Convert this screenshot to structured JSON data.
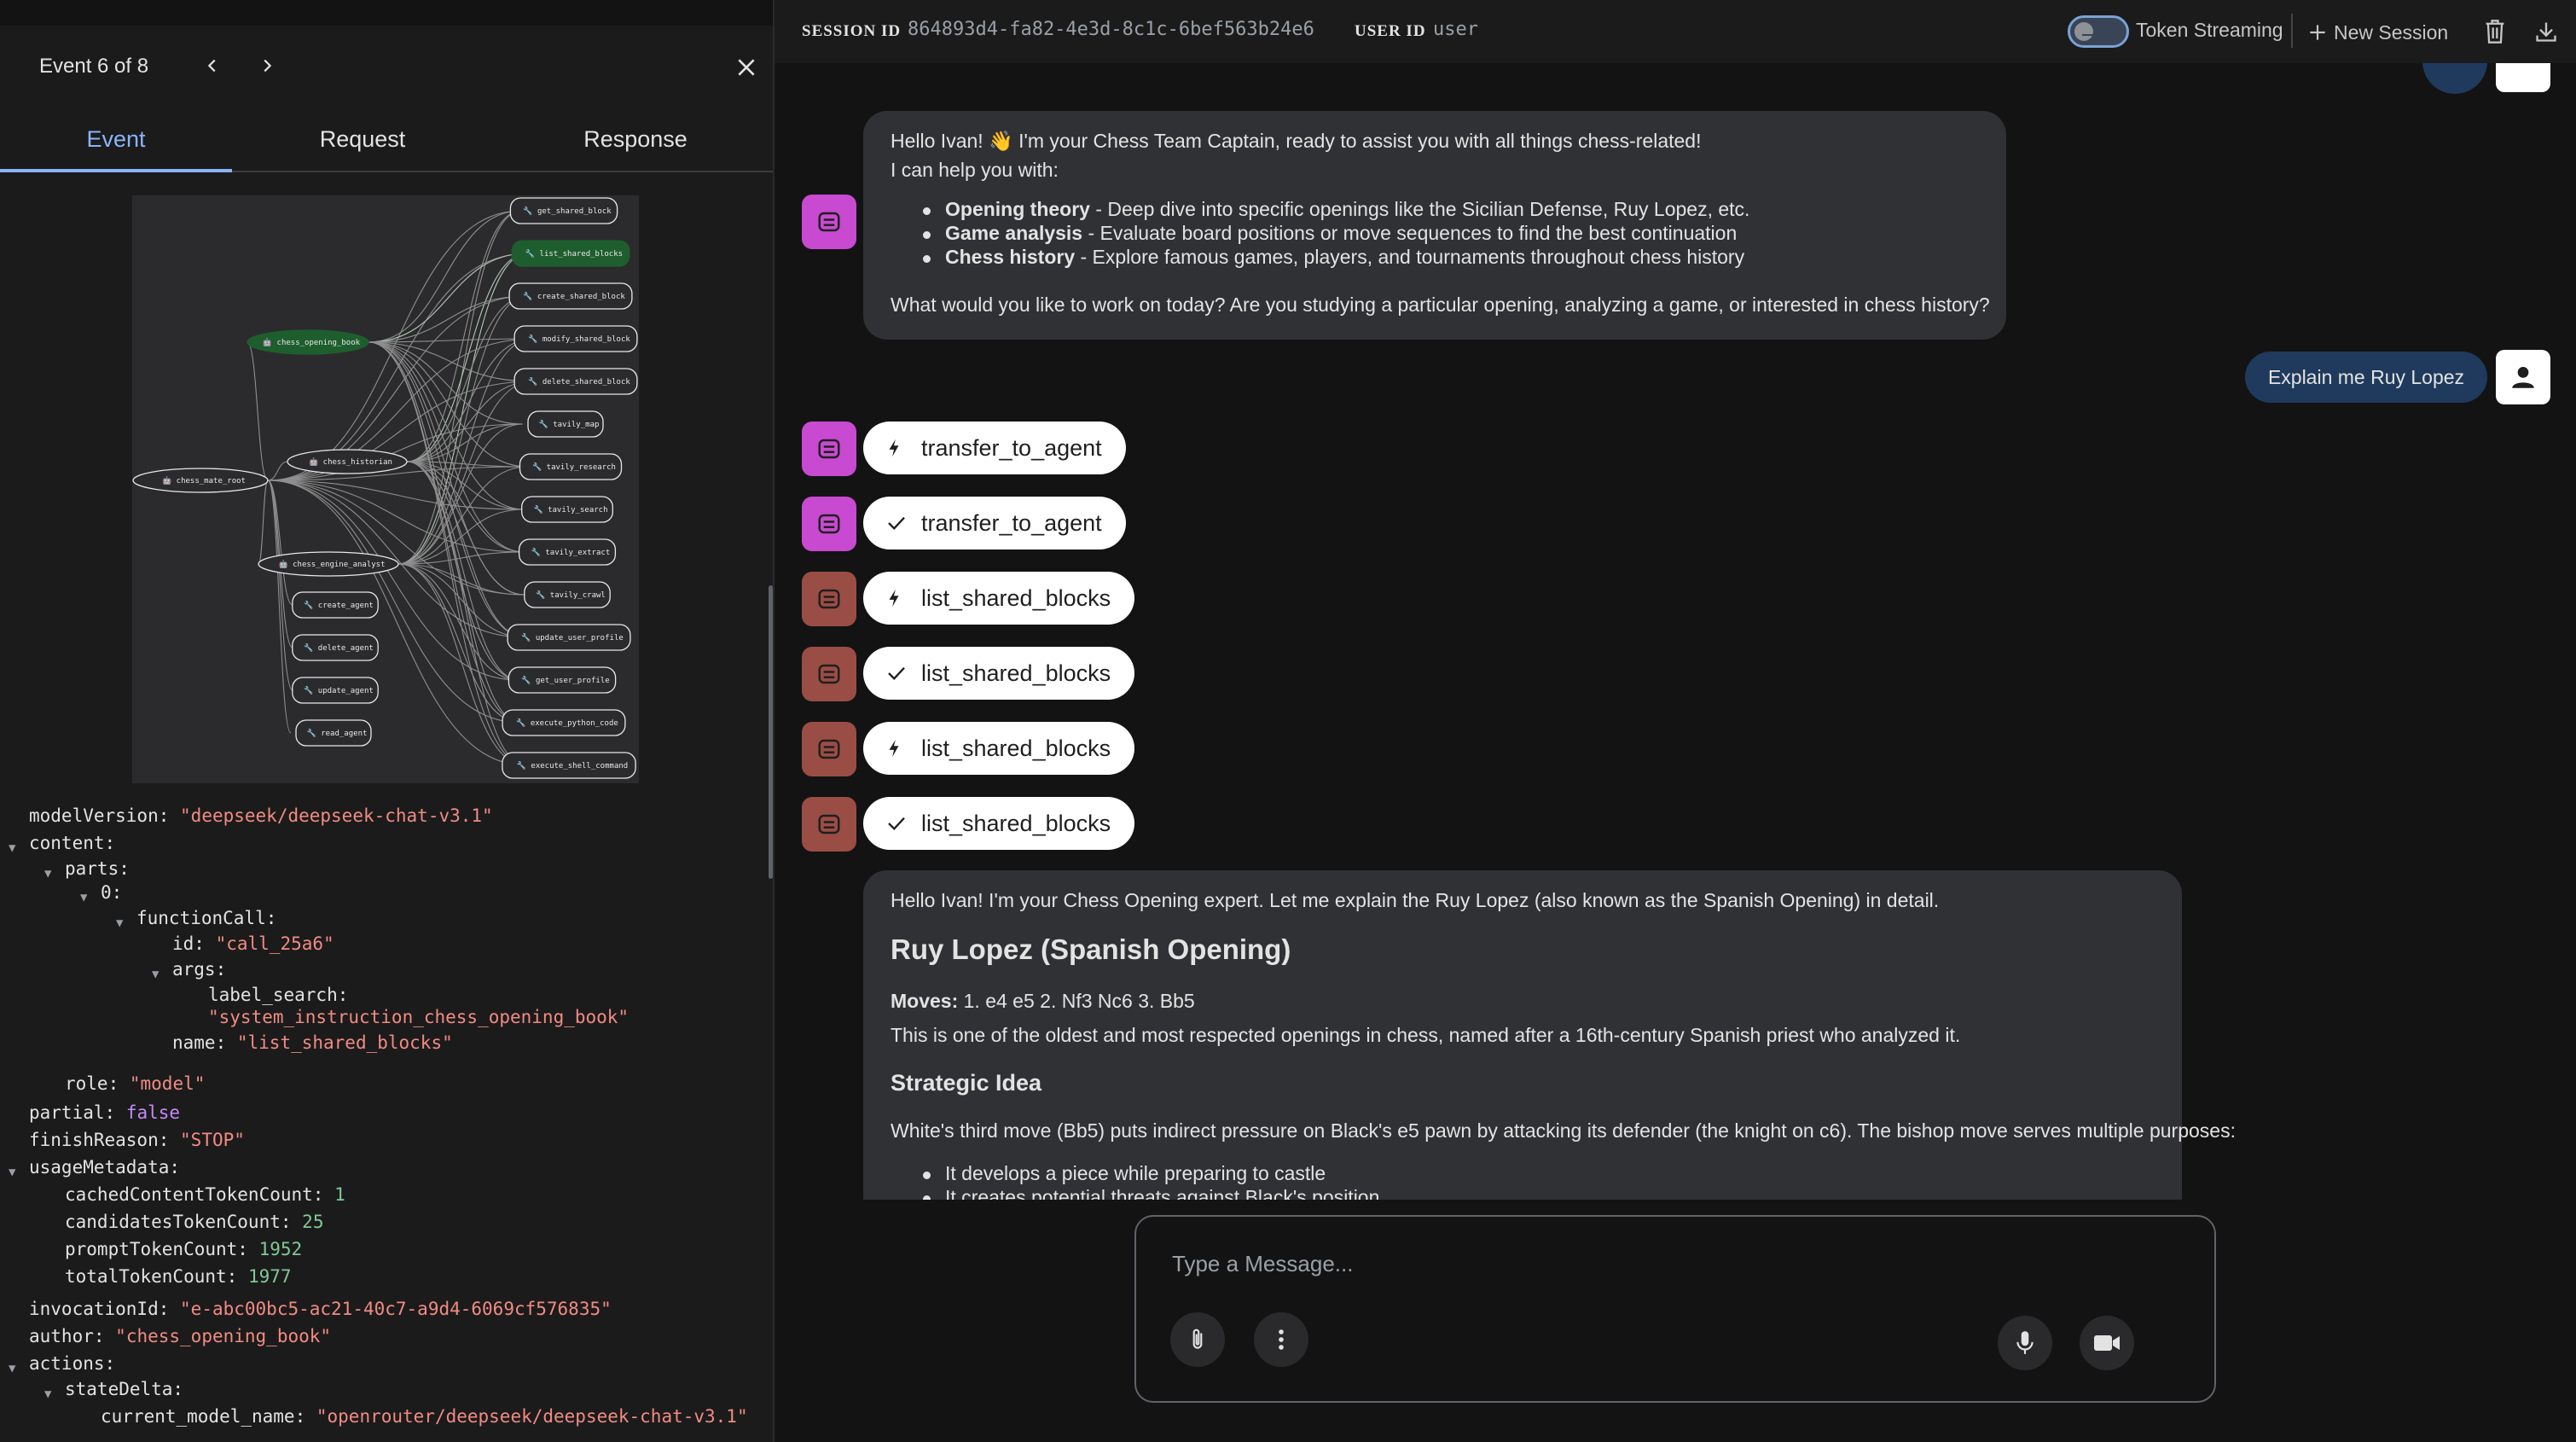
{
  "event_panel": {
    "counter": "Event 6 of 8",
    "tabs": [
      "Event",
      "Request",
      "Response"
    ],
    "graph": {
      "root": "chess_mate_root",
      "agents": [
        "chess_opening_book",
        "chess_historian",
        "chess_engine_analyst"
      ],
      "tools": [
        "get_shared_block",
        "list_shared_blocks",
        "create_shared_block",
        "modify_shared_block",
        "delete_shared_block",
        "tavily_map",
        "tavily_research",
        "tavily_search",
        "tavily_extract",
        "tavily_crawl",
        "update_user_profile",
        "get_user_profile",
        "execute_python_code",
        "execute_shell_command",
        "create_agent",
        "delete_agent",
        "update_agent",
        "read_agent"
      ],
      "highlighted": [
        "chess_opening_book",
        "list_shared_blocks"
      ]
    },
    "json_lines": {
      "model_version_key": "modelVersion:",
      "model_version": "\"deepseek/deepseek-chat-v3.1\"",
      "content_key": "content:",
      "parts_key": "parts:",
      "index_key": "0:",
      "function_call_key": "functionCall:",
      "id_key": "id:",
      "id": "\"call_25a6\"",
      "args_key": "args:",
      "label_search_key": "label_search:",
      "label_search": "\"system_instruction_chess_opening_book\"",
      "name_key": "name:",
      "name": "\"list_shared_blocks\"",
      "role_key": "role:",
      "role": "\"model\"",
      "partial_key": "partial:",
      "partial": "false",
      "finish_reason_key": "finishReason:",
      "finish_reason": "\"STOP\"",
      "usage_key": "usageMetadata:",
      "cached_key": "cachedContentTokenCount:",
      "cached": "1",
      "candidates_key": "candidatesTokenCount:",
      "candidates": "25",
      "prompt_key": "promptTokenCount:",
      "prompt": "1952",
      "total_key": "totalTokenCount:",
      "total": "1977",
      "invocation_key": "invocationId:",
      "invocation": "\"e-abc00bc5-ac21-40c7-a9d4-6069cf576835\"",
      "author_key": "author:",
      "author": "\"chess_opening_book\"",
      "actions_key": "actions:",
      "state_delta_key": "stateDelta:",
      "current_model_key": "current_model_name:",
      "current_model": "\"openrouter/deepseek/deepseek-chat-v3.1\""
    }
  },
  "header": {
    "session_label": "SESSION ID",
    "session_id": "864893d4-fa82-4e3d-8c1c-6bef563b24e6",
    "user_label": "USER ID",
    "user_id": "user",
    "token_streaming": "Token Streaming",
    "token_streaming_on": false,
    "new_session": "New Session"
  },
  "chat": {
    "captain_message": {
      "greeting": "Hello Ivan! 👋 I'm your Chess Team Captain, ready to assist you with all things chess-related!",
      "intro": "I can help you with:",
      "items": [
        {
          "title": "Opening theory",
          "text": " - Deep dive into specific openings like the Sicilian Defense, Ruy Lopez, etc."
        },
        {
          "title": "Game analysis",
          "text": " - Evaluate board positions or move sequences to find the best continuation"
        },
        {
          "title": "Chess history",
          "text": " - Explore famous games, players, and tournaments throughout chess history"
        }
      ],
      "question": "What would you like to work on today? Are you studying a particular opening, analyzing a game, or interested in chess history?"
    },
    "user_message": "Explain me Ruy Lopez",
    "events": [
      {
        "kind": "call",
        "label": "transfer_to_agent"
      },
      {
        "kind": "response",
        "label": "transfer_to_agent"
      },
      {
        "kind": "call",
        "label": "list_shared_blocks"
      },
      {
        "kind": "response",
        "label": "list_shared_blocks"
      },
      {
        "kind": "call",
        "label": "list_shared_blocks"
      },
      {
        "kind": "response",
        "label": "list_shared_blocks"
      }
    ],
    "expert_message": {
      "intro": "Hello Ivan! I'm your Chess Opening expert. Let me explain the Ruy Lopez (also known as the Spanish Opening) in detail.",
      "heading": "Ruy Lopez (Spanish Opening)",
      "moves_label": "Moves:",
      "moves": " 1. e4 e5 2. Nf3 Nc6 3. Bb5",
      "history": "This is one of the oldest and most respected openings in chess, named after a 16th-century Spanish priest who analyzed it.",
      "subheading": "Strategic Idea",
      "strategy": "White's third move (Bb5) puts indirect pressure on Black's e5 pawn by attacking its defender (the knight on c6). The bishop move serves multiple purposes:",
      "bullets": [
        "It develops a piece while preparing to castle",
        "It creates potential threats against Black's position"
      ]
    }
  },
  "composer": {
    "placeholder": "Type a Message..."
  },
  "colors": {
    "accent": "#8ab4f8",
    "captain_avatar": "#c84ad0",
    "tool_avatar": "#9a4d45",
    "user_bubble": "#1f3a5c",
    "json_string": "#f28b82",
    "json_number": "#81c995",
    "json_boolean": "#c58af9"
  }
}
